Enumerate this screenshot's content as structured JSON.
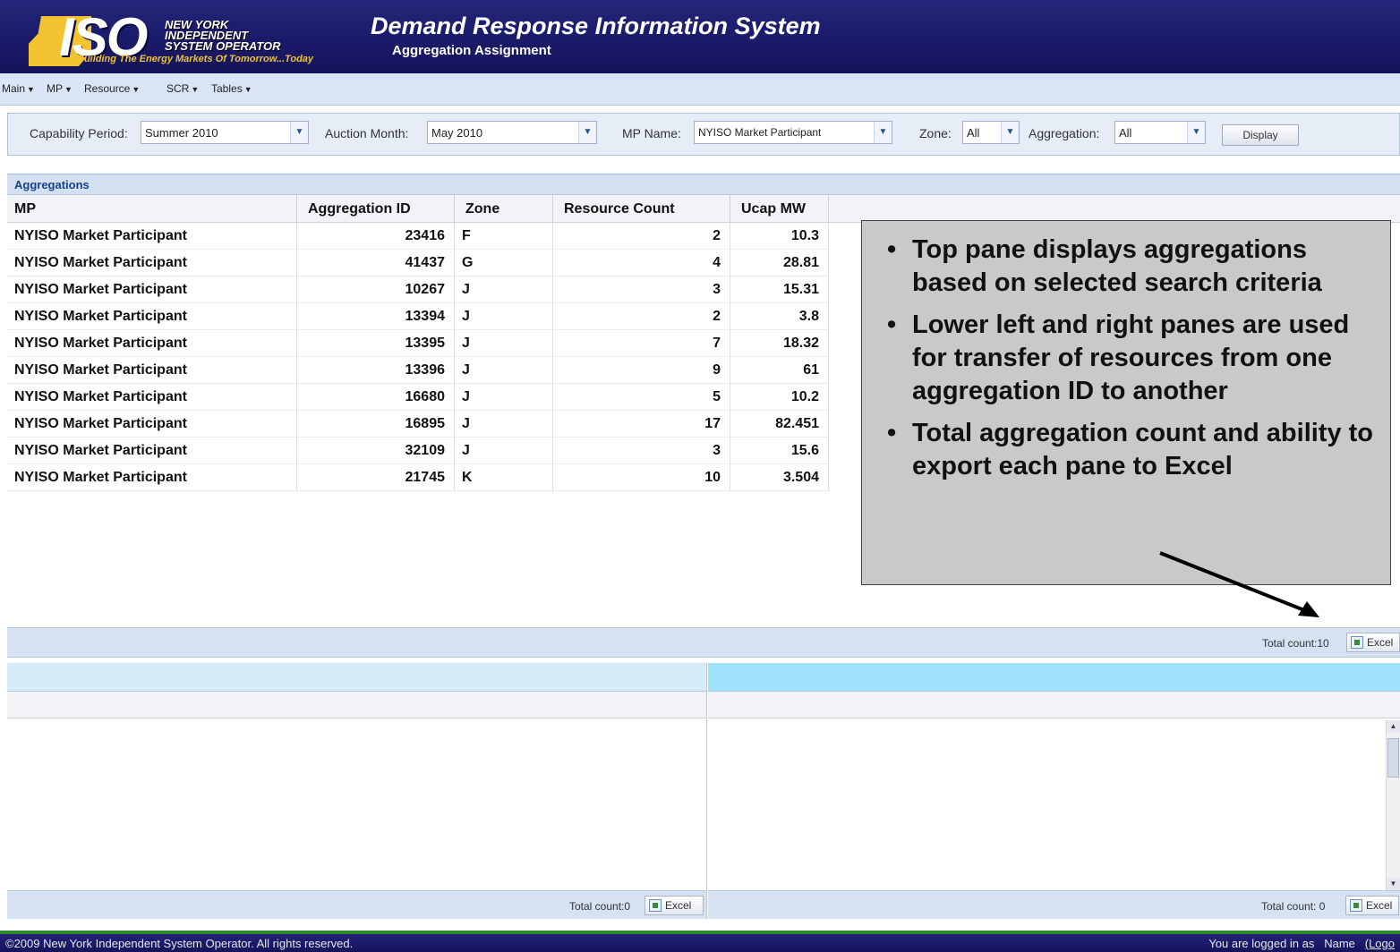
{
  "header": {
    "org_lines": [
      "NEW YORK",
      "INDEPENDENT",
      "SYSTEM OPERATOR"
    ],
    "logo_text": "ISO",
    "tagline": "Building The Energy Markets Of Tomorrow...Today",
    "app_title": "Demand Response Information System",
    "subtitle": "Aggregation Assignment"
  },
  "menu": [
    {
      "label": "Main"
    },
    {
      "label": "MP"
    },
    {
      "label": "Resource"
    },
    {
      "label": "SCR"
    },
    {
      "label": "Tables"
    }
  ],
  "filters": {
    "capability_period": {
      "label": "Capability Period:",
      "value": "Summer 2010"
    },
    "auction_month": {
      "label": "Auction Month:",
      "value": "May 2010"
    },
    "mp_name": {
      "label": "MP Name:",
      "value": "NYISO Market Participant"
    },
    "zone": {
      "label": "Zone:",
      "value": "All"
    },
    "aggregation": {
      "label": "Aggregation:",
      "value": "All"
    },
    "display_button": "Display"
  },
  "aggregations": {
    "title": "Aggregations",
    "columns": [
      "MP",
      "Aggregation ID",
      "Zone",
      "Resource Count",
      "Ucap MW"
    ],
    "rows": [
      [
        "NYISO Market Participant",
        "23416",
        "F",
        "2",
        "10.3"
      ],
      [
        "NYISO Market Participant",
        "41437",
        "G",
        "4",
        "28.81"
      ],
      [
        "NYISO Market Participant",
        "10267",
        "J",
        "3",
        "15.31"
      ],
      [
        "NYISO Market Participant",
        "13394",
        "J",
        "2",
        "3.8"
      ],
      [
        "NYISO Market Participant",
        "13395",
        "J",
        "7",
        "18.32"
      ],
      [
        "NYISO Market Participant",
        "13396",
        "J",
        "9",
        "61"
      ],
      [
        "NYISO Market Participant",
        "16680",
        "J",
        "5",
        "10.2"
      ],
      [
        "NYISO Market Participant",
        "16895",
        "J",
        "17",
        "82.451"
      ],
      [
        "NYISO Market Participant",
        "32109",
        "J",
        "3",
        "15.6"
      ],
      [
        "NYISO Market Participant",
        "21745",
        "K",
        "10",
        "3.504"
      ]
    ],
    "total_label": "Total count:",
    "total_value": "10",
    "excel_label": "Excel"
  },
  "lower_left": {
    "total_label": "Total count:",
    "total_value": "0",
    "excel_label": "Excel"
  },
  "lower_right": {
    "total_label": "Total count:",
    "total_value": "0",
    "excel_label": "Excel"
  },
  "callout": {
    "bullets": [
      "Top pane displays aggregations based on selected search criteria",
      "Lower left and right panes are used for transfer of resources from one aggregation ID to another",
      "Total aggregation count and ability to export each pane to Excel"
    ]
  },
  "status": {
    "copyright": "©2009  New York Independent System Operator. All rights reserved.",
    "logged_in_prefix": "You are logged in as",
    "user_name": "Name",
    "logout": "(Logo"
  },
  "colors": {
    "header_bg": "#1c1c6e",
    "logo_yellow": "#f2c230",
    "menu_bg": "#d9e5f4",
    "panel_title_text": "#15428b",
    "callout_bg": "#c9c9c9",
    "status_green": "#2c8a2c"
  }
}
